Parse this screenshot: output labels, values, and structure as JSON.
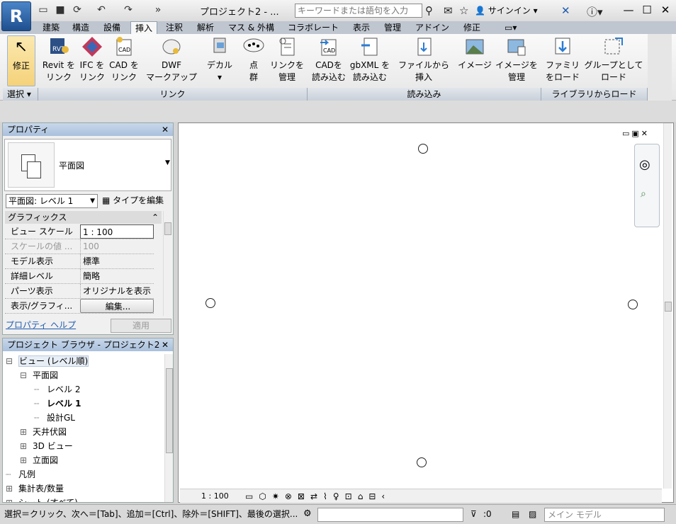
{
  "app": {
    "logo": "R",
    "title": "プロジェクト2 - ...",
    "search_placeholder": "キーワードまたは語句を入力",
    "signin": "サインイン"
  },
  "qat_icons": [
    "open-icon",
    "save-icon",
    "sync-icon",
    "undo-icon",
    "redo-icon",
    "more-icon"
  ],
  "tabs": [
    "建築",
    "構造",
    "設備",
    "挿入",
    "注釈",
    "解析",
    "マス & 外構",
    "コラボレート",
    "表示",
    "管理",
    "アドイン",
    "修正"
  ],
  "active_tab": "挿入",
  "ribbon": {
    "modify": "修正",
    "select_panel": "選択 ▾",
    "link_panel": "リンク",
    "import_panel": "読み込み",
    "library_panel": "ライブラリからロード",
    "buttons": [
      {
        "l1": "Revit を",
        "l2": "リンク"
      },
      {
        "l1": "IFC を",
        "l2": "リンク"
      },
      {
        "l1": "CAD を",
        "l2": "リンク"
      },
      {
        "l1": "DWF",
        "l2": "マークアップ"
      },
      {
        "l1": "デカル",
        "l2": "▾"
      },
      {
        "l1": "点",
        "l2": "群"
      },
      {
        "l1": "リンクを",
        "l2": "管理"
      },
      {
        "l1": "CADを",
        "l2": "読み込む"
      },
      {
        "l1": "gbXML を",
        "l2": "読み込む"
      },
      {
        "l1": "ファイルから",
        "l2": "挿入"
      },
      {
        "l1": "イメージ",
        "l2": ""
      },
      {
        "l1": "イメージを",
        "l2": "管理"
      },
      {
        "l1": "ファミリ",
        "l2": "をロード"
      },
      {
        "l1": "グループとして",
        "l2": "ロード"
      }
    ]
  },
  "properties": {
    "title": "プロパティ",
    "type_name": "平面図",
    "selector": "平面図: レベル 1",
    "edit_type": "タイプを編集",
    "group": "グラフィックス",
    "rows": [
      {
        "k": "ビュー スケール",
        "v": "1 : 100"
      },
      {
        "k": "スケールの値 ...",
        "v": "100"
      },
      {
        "k": "モデル表示",
        "v": "標準"
      },
      {
        "k": "詳細レベル",
        "v": "簡略"
      },
      {
        "k": "パーツ表示",
        "v": "オリジナルを表示"
      },
      {
        "k": "表示/グラフィ...",
        "v": "編集..."
      }
    ],
    "help": "プロパティ ヘルプ",
    "apply": "適用"
  },
  "browser": {
    "title": "プロジェクト ブラウザ - プロジェクト2",
    "items": [
      {
        "t": "ビュー (レベル順)",
        "sign": "⊟",
        "indent": 0
      },
      {
        "t": "平面図",
        "sign": "⊟",
        "indent": 1
      },
      {
        "t": "レベル 2",
        "sign": "",
        "indent": 2
      },
      {
        "t": "レベル 1",
        "sign": "",
        "indent": 2
      },
      {
        "t": "設計GL",
        "sign": "",
        "indent": 2
      },
      {
        "t": "天井伏図",
        "sign": "⊞",
        "indent": 1
      },
      {
        "t": "3D ビュー",
        "sign": "⊞",
        "indent": 1
      },
      {
        "t": "立面図",
        "sign": "⊞",
        "indent": 1
      },
      {
        "t": "凡例",
        "sign": "",
        "indent": 0
      },
      {
        "t": "集計表/数量",
        "sign": "⊞",
        "indent": 0
      },
      {
        "t": "シート (すべて)",
        "sign": "⊞",
        "indent": 0
      }
    ],
    "bold_item": "レベル 1"
  },
  "view": {
    "scale": "1 : 100"
  },
  "status": {
    "message": "選択＝クリック、次へ＝[Tab]、追加＝[Ctrl]、除外＝[SHIFT]、最後の選択...",
    "filter_count": ":0",
    "model": "メイン モデル"
  }
}
